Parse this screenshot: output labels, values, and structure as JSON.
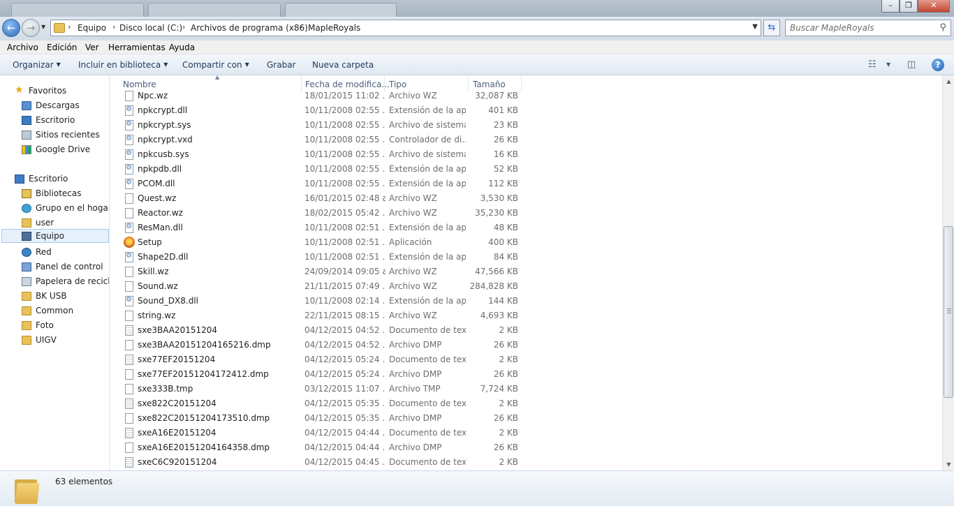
{
  "address": {
    "crumbs": [
      "Equipo",
      "Disco local (C:)",
      "Archivos de programa (x86)",
      "MapleRoyals"
    ],
    "search_placeholder": "Buscar MapleRoyals"
  },
  "menu": [
    "Archivo",
    "Edición",
    "Ver",
    "Herramientas",
    "Ayuda"
  ],
  "commands": {
    "organize": "Organizar",
    "include_library": "Incluir en biblioteca",
    "share": "Compartir con",
    "burn": "Grabar",
    "new_folder": "Nueva carpeta"
  },
  "nav": {
    "favorites_header": "Favoritos",
    "favorites": [
      "Descargas",
      "Escritorio",
      "Sitios recientes",
      "Google Drive"
    ],
    "desktop_header": "Escritorio",
    "desktop_items": [
      "Bibliotecas",
      "Grupo en el hogar",
      "user",
      "Equipo",
      "Red",
      "Panel de control",
      "Papelera de reciclaje",
      "BK USB",
      "Common",
      "Foto",
      "UIGV"
    ],
    "selected": "Equipo"
  },
  "columns": {
    "name": "Nombre",
    "date": "Fecha de modifica...",
    "type": "Tipo",
    "size": "Tamaño"
  },
  "files": [
    {
      "name": "Npc.wz",
      "date": "18/01/2015 11:02 ...",
      "type": "Archivo WZ",
      "size": "32,087 KB",
      "icon": "file"
    },
    {
      "name": "npkcrypt.dll",
      "date": "10/11/2008 02:55 ...",
      "type": "Extensión de la apl...",
      "size": "401 KB",
      "icon": "dll"
    },
    {
      "name": "npkcrypt.sys",
      "date": "10/11/2008 02:55 ...",
      "type": "Archivo de sistema",
      "size": "23 KB",
      "icon": "dll"
    },
    {
      "name": "npkcrypt.vxd",
      "date": "10/11/2008 02:55 ...",
      "type": "Controlador de di...",
      "size": "26 KB",
      "icon": "dll"
    },
    {
      "name": "npkcusb.sys",
      "date": "10/11/2008 02:55 ...",
      "type": "Archivo de sistema",
      "size": "16 KB",
      "icon": "dll"
    },
    {
      "name": "npkpdb.dll",
      "date": "10/11/2008 02:55 ...",
      "type": "Extensión de la apl...",
      "size": "52 KB",
      "icon": "dll"
    },
    {
      "name": "PCOM.dll",
      "date": "10/11/2008 02:55 ...",
      "type": "Extensión de la apl...",
      "size": "112 KB",
      "icon": "dll"
    },
    {
      "name": "Quest.wz",
      "date": "16/01/2015 02:48 a...",
      "type": "Archivo WZ",
      "size": "3,530 KB",
      "icon": "file"
    },
    {
      "name": "Reactor.wz",
      "date": "18/02/2015 05:42 ...",
      "type": "Archivo WZ",
      "size": "35,230 KB",
      "icon": "file"
    },
    {
      "name": "ResMan.dll",
      "date": "10/11/2008 02:51 ...",
      "type": "Extensión de la apl...",
      "size": "48 KB",
      "icon": "dll"
    },
    {
      "name": "Setup",
      "date": "10/11/2008 02:51 ...",
      "type": "Aplicación",
      "size": "400 KB",
      "icon": "app"
    },
    {
      "name": "Shape2D.dll",
      "date": "10/11/2008 02:51 ...",
      "type": "Extensión de la apl...",
      "size": "84 KB",
      "icon": "dll"
    },
    {
      "name": "Skill.wz",
      "date": "24/09/2014 09:05 a...",
      "type": "Archivo WZ",
      "size": "47,566 KB",
      "icon": "file"
    },
    {
      "name": "Sound.wz",
      "date": "21/11/2015 07:49 ...",
      "type": "Archivo WZ",
      "size": "284,828 KB",
      "icon": "file"
    },
    {
      "name": "Sound_DX8.dll",
      "date": "10/11/2008 02:14 ...",
      "type": "Extensión de la apl...",
      "size": "144 KB",
      "icon": "dll"
    },
    {
      "name": "string.wz",
      "date": "22/11/2015 08:15 ...",
      "type": "Archivo WZ",
      "size": "4,693 KB",
      "icon": "file"
    },
    {
      "name": "sxe3BAA20151204",
      "date": "04/12/2015 04:52 ...",
      "type": "Documento de tex...",
      "size": "2 KB",
      "icon": "txt"
    },
    {
      "name": "sxe3BAA20151204165216.dmp",
      "date": "04/12/2015 04:52 ...",
      "type": "Archivo DMP",
      "size": "26 KB",
      "icon": "file"
    },
    {
      "name": "sxe77EF20151204",
      "date": "04/12/2015 05:24 ...",
      "type": "Documento de tex...",
      "size": "2 KB",
      "icon": "txt"
    },
    {
      "name": "sxe77EF20151204172412.dmp",
      "date": "04/12/2015 05:24 ...",
      "type": "Archivo DMP",
      "size": "26 KB",
      "icon": "file"
    },
    {
      "name": "sxe333B.tmp",
      "date": "03/12/2015 11:07 ...",
      "type": "Archivo TMP",
      "size": "7,724 KB",
      "icon": "file"
    },
    {
      "name": "sxe822C20151204",
      "date": "04/12/2015 05:35 ...",
      "type": "Documento de tex...",
      "size": "2 KB",
      "icon": "txt"
    },
    {
      "name": "sxe822C20151204173510.dmp",
      "date": "04/12/2015 05:35 ...",
      "type": "Archivo DMP",
      "size": "26 KB",
      "icon": "file"
    },
    {
      "name": "sxeA16E20151204",
      "date": "04/12/2015 04:44 ...",
      "type": "Documento de tex...",
      "size": "2 KB",
      "icon": "txt"
    },
    {
      "name": "sxeA16E20151204164358.dmp",
      "date": "04/12/2015 04:44 ...",
      "type": "Archivo DMP",
      "size": "26 KB",
      "icon": "file"
    },
    {
      "name": "sxeC6C920151204",
      "date": "04/12/2015 04:45 ...",
      "type": "Documento de tex...",
      "size": "2 KB",
      "icon": "txt"
    }
  ],
  "status": {
    "count": "63 elementos"
  }
}
